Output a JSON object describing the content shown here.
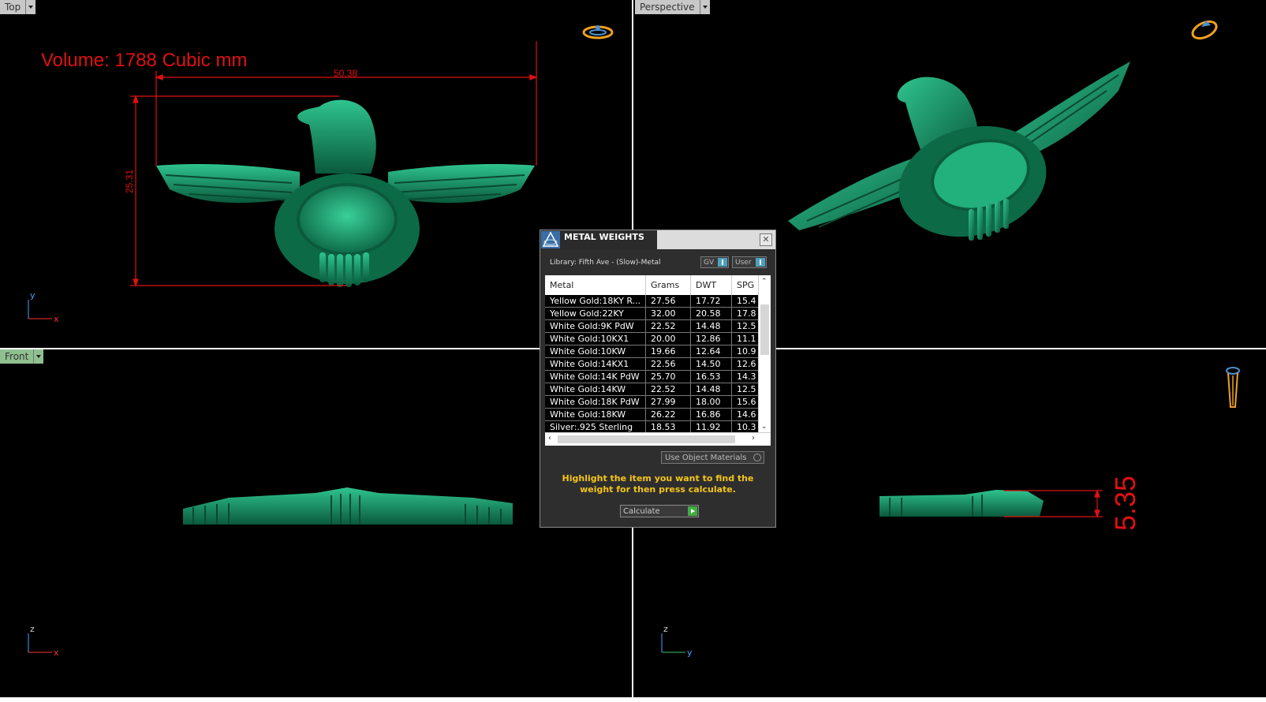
{
  "viewports": {
    "top": {
      "label": "Top",
      "volume_text": "Volume: 1788 Cubic mm",
      "dim_width": "50.38",
      "dim_height": "25.31",
      "axis_v": "y",
      "axis_h": "x"
    },
    "perspective": {
      "label": "Perspective"
    },
    "front": {
      "label": "Front",
      "axis_v": "z",
      "axis_h": "x"
    },
    "right": {
      "dim_depth": "5.35",
      "axis_v": "z",
      "axis_h": "y"
    }
  },
  "dialog": {
    "title": "METAL WEIGHTS",
    "library": "Library: Fifth Ave - (Slow)-Metal",
    "sel_gv": "GV",
    "sel_user": "User",
    "columns": [
      "Metal",
      "Grams",
      "DWT",
      "SPG"
    ],
    "rows": [
      [
        "Yellow Gold:18KY R...",
        "27.56",
        "17.72",
        "15.4"
      ],
      [
        "Yellow Gold:22KY",
        "32.00",
        "20.58",
        "17.8"
      ],
      [
        "White Gold:9K PdW",
        "22.52",
        "14.48",
        "12.5"
      ],
      [
        "White Gold:10KX1",
        "20.00",
        "12.86",
        "11.1"
      ],
      [
        "White Gold:10KW",
        "19.66",
        "12.64",
        "10.9"
      ],
      [
        "White Gold:14KX1",
        "22.56",
        "14.50",
        "12.6"
      ],
      [
        "White Gold:14K PdW",
        "25.70",
        "16.53",
        "14.3"
      ],
      [
        "White Gold:14KW",
        "22.52",
        "14.48",
        "12.5"
      ],
      [
        "White Gold:18K PdW",
        "27.99",
        "18.00",
        "15.6"
      ],
      [
        "White Gold:18KW",
        "26.22",
        "16.86",
        "14.6"
      ],
      [
        "Silver:.925 Sterling",
        "18.53",
        "11.92",
        "10.3"
      ]
    ],
    "use_object_materials": "Use Object Materials",
    "hint": "Highlight the item you want to find the weight for then press calculate.",
    "calculate": "Calculate"
  },
  "colors": {
    "model": "#1a8c63",
    "dimension": "#e01010",
    "viewport_bg": "#000000",
    "active_label": "#8fc08f"
  }
}
